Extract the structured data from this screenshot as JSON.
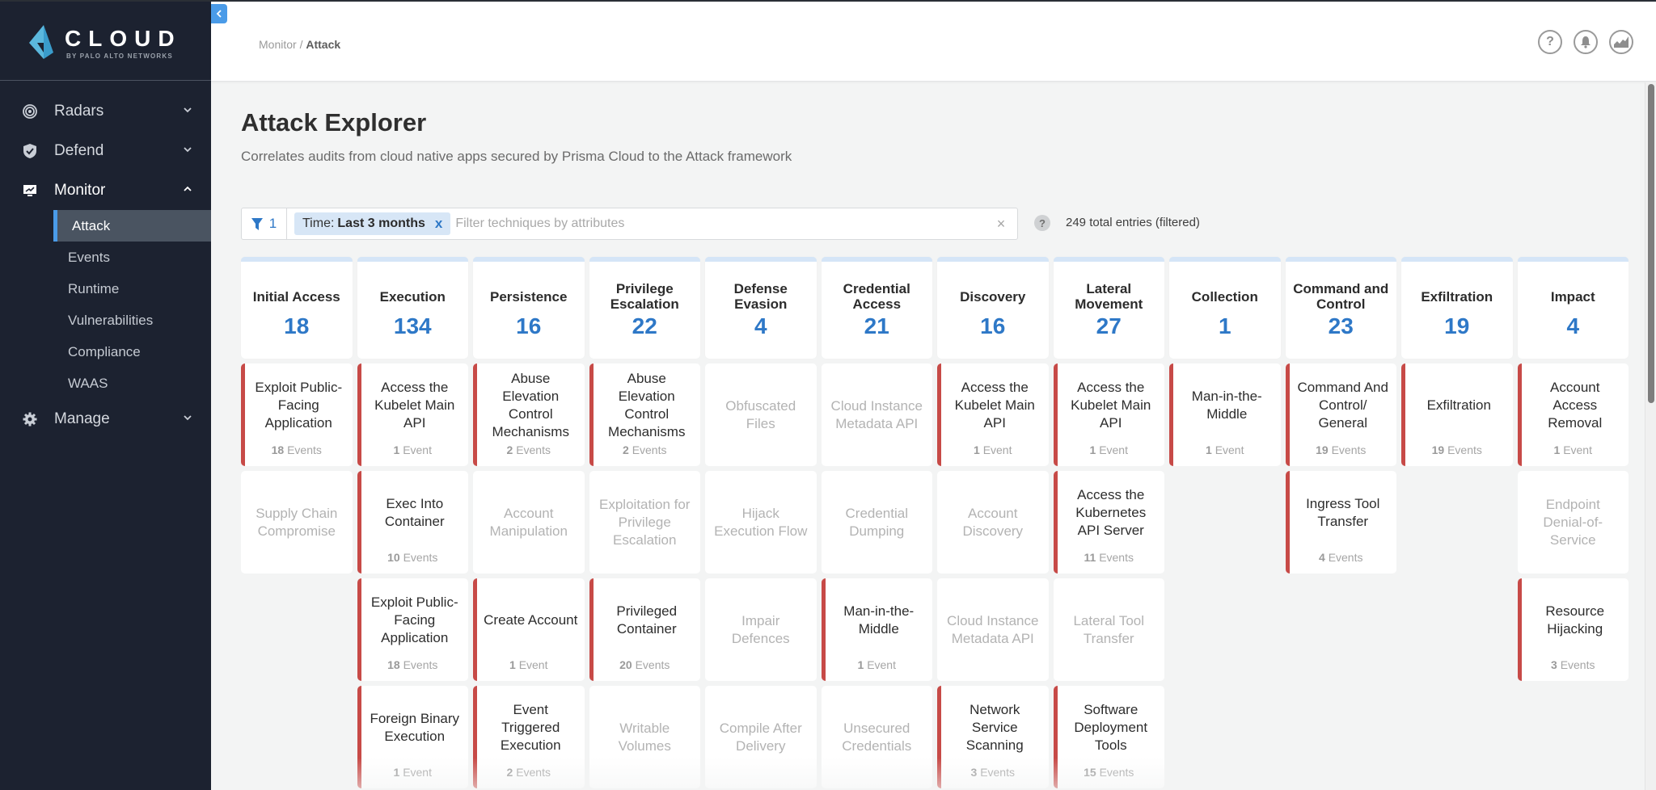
{
  "brand": {
    "name": "CLOUD",
    "sub": "BY PALO ALTO NETWORKS",
    "accent": "#4a9be8",
    "alert": "#c74a47"
  },
  "sidebar": {
    "items": [
      {
        "label": "Radars",
        "icon": "radar-icon",
        "expanded": false
      },
      {
        "label": "Defend",
        "icon": "shield-icon",
        "expanded": false
      },
      {
        "label": "Monitor",
        "icon": "monitor-icon",
        "expanded": true,
        "children": [
          "Attack",
          "Events",
          "Runtime",
          "Vulnerabilities",
          "Compliance",
          "WAAS"
        ],
        "active": "Attack"
      },
      {
        "label": "Manage",
        "icon": "gear-icon",
        "expanded": false
      }
    ]
  },
  "header": {
    "breadcrumb": {
      "parent": "Monitor",
      "separator": " / ",
      "current": "Attack"
    },
    "icons": [
      "help-icon",
      "bell-icon",
      "chart-icon"
    ],
    "help_glyph": "?"
  },
  "page": {
    "title": "Attack Explorer",
    "subtitle": "Correlates audits from cloud native apps secured by Prisma Cloud to the Attack framework"
  },
  "filter": {
    "count": "1",
    "chip_key": "Time:",
    "chip_value": "Last 3 months",
    "chip_remove": "x",
    "placeholder": "Filter techniques by attributes",
    "value": "",
    "clear": "×",
    "help": "?",
    "total": "249 total entries (filtered)"
  },
  "matrix": [
    {
      "tactic": "Initial Access",
      "count": "18",
      "techniques": [
        {
          "name": "Exploit Public-Facing Application",
          "events": "18",
          "unit": "Events"
        },
        {
          "name": "Supply Chain Compromise"
        }
      ]
    },
    {
      "tactic": "Execution",
      "count": "134",
      "techniques": [
        {
          "name": "Access the Kubelet Main API",
          "events": "1",
          "unit": "Event"
        },
        {
          "name": "Exec Into Container",
          "events": "10",
          "unit": "Events"
        },
        {
          "name": "Exploit Public-Facing Application",
          "events": "18",
          "unit": "Events"
        },
        {
          "name": "Foreign Binary Execution",
          "events": "1",
          "unit": "Event"
        }
      ]
    },
    {
      "tactic": "Persistence",
      "count": "16",
      "techniques": [
        {
          "name": "Abuse Elevation Control Mechanisms",
          "events": "2",
          "unit": "Events"
        },
        {
          "name": "Account Manipulation"
        },
        {
          "name": "Create Account",
          "events": "1",
          "unit": "Event"
        },
        {
          "name": "Event Triggered Execution",
          "events": "2",
          "unit": "Events"
        }
      ]
    },
    {
      "tactic": "Privilege Escalation",
      "count": "22",
      "techniques": [
        {
          "name": "Abuse Elevation Control Mechanisms",
          "events": "2",
          "unit": "Events"
        },
        {
          "name": "Exploitation for Privilege Escalation"
        },
        {
          "name": "Privileged Container",
          "events": "20",
          "unit": "Events"
        },
        {
          "name": "Writable Volumes"
        }
      ]
    },
    {
      "tactic": "Defense Evasion",
      "count": "4",
      "techniques": [
        {
          "name": "Obfuscated Files"
        },
        {
          "name": "Hijack Execution Flow"
        },
        {
          "name": "Impair Defences"
        },
        {
          "name": "Compile After Delivery"
        }
      ]
    },
    {
      "tactic": "Credential Access",
      "count": "21",
      "techniques": [
        {
          "name": "Cloud Instance Metadata API"
        },
        {
          "name": "Credential Dumping"
        },
        {
          "name": "Man-in-the-Middle",
          "events": "1",
          "unit": "Event"
        },
        {
          "name": "Unsecured Credentials"
        }
      ]
    },
    {
      "tactic": "Discovery",
      "count": "16",
      "techniques": [
        {
          "name": "Access the Kubelet Main API",
          "events": "1",
          "unit": "Event"
        },
        {
          "name": "Account Discovery"
        },
        {
          "name": "Cloud Instance Metadata API"
        },
        {
          "name": "Network Service Scanning",
          "events": "3",
          "unit": "Events"
        }
      ]
    },
    {
      "tactic": "Lateral Movement",
      "count": "27",
      "techniques": [
        {
          "name": "Access the Kubelet Main API",
          "events": "1",
          "unit": "Event"
        },
        {
          "name": "Access the Kubernetes API Server",
          "events": "11",
          "unit": "Events"
        },
        {
          "name": "Lateral Tool Transfer"
        },
        {
          "name": "Software Deployment Tools",
          "events": "15",
          "unit": "Events"
        }
      ]
    },
    {
      "tactic": "Collection",
      "count": "1",
      "techniques": [
        {
          "name": "Man-in-the-Middle",
          "events": "1",
          "unit": "Event"
        }
      ]
    },
    {
      "tactic": "Command and Control",
      "count": "23",
      "techniques": [
        {
          "name": "Command And Control/ General",
          "events": "19",
          "unit": "Events"
        },
        {
          "name": "Ingress Tool Transfer",
          "events": "4",
          "unit": "Events"
        }
      ]
    },
    {
      "tactic": "Exfiltration",
      "count": "19",
      "techniques": [
        {
          "name": "Exfiltration",
          "events": "19",
          "unit": "Events"
        }
      ]
    },
    {
      "tactic": "Impact",
      "count": "4",
      "techniques": [
        {
          "name": "Account Access Removal",
          "events": "1",
          "unit": "Event"
        },
        {
          "name": "Endpoint Denial-of-Service"
        },
        {
          "name": "Resource Hijacking",
          "events": "3",
          "unit": "Events"
        }
      ]
    }
  ]
}
